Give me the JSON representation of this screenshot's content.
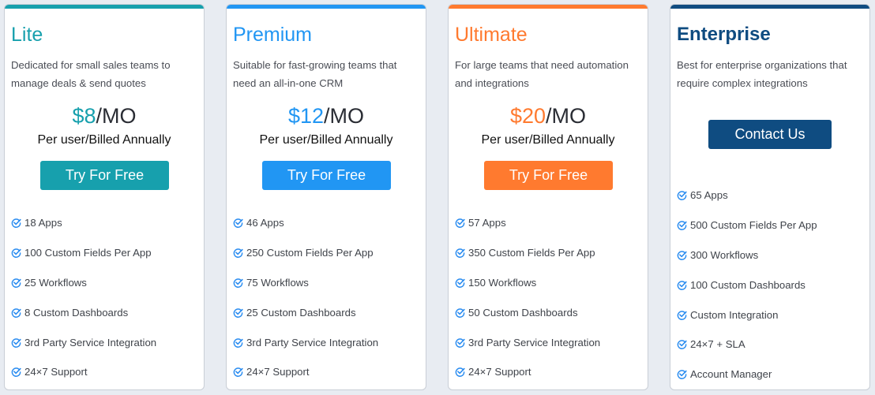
{
  "plans": [
    {
      "id": "lite",
      "name": "Lite",
      "accent": "#17a0ad",
      "title_color": "#17a0ad",
      "description": "Dedicated for small sales teams to manage deals & send quotes",
      "price_amount": "$8",
      "price_unit": "/MO",
      "billing": "Per user/Billed Annually",
      "cta_label": "Try For Free",
      "features": [
        "18 Apps",
        "100 Custom Fields Per App",
        "25 Workflows",
        "8 Custom Dashboards",
        "3rd Party Service Integration",
        "24×7 Support"
      ]
    },
    {
      "id": "premium",
      "name": "Premium",
      "accent": "#2196f3",
      "title_color": "#2196f3",
      "description": "Suitable for fast-growing teams that need an all-in-one CRM",
      "price_amount": "$12",
      "price_unit": "/MO",
      "billing": "Per user/Billed Annually",
      "cta_label": "Try For Free",
      "features": [
        "46 Apps",
        "250 Custom Fields Per App",
        "75 Workflows",
        "25 Custom Dashboards",
        "3rd Party Service Integration",
        "24×7 Support"
      ]
    },
    {
      "id": "ultimate",
      "name": "Ultimate",
      "accent": "#ff7a2f",
      "title_color": "#ff7a2f",
      "description": "For large teams that need automation and integrations",
      "price_amount": "$20",
      "price_unit": "/MO",
      "billing": "Per user/Billed Annually",
      "cta_label": "Try For Free",
      "features": [
        "57 Apps",
        "350 Custom Fields Per App",
        "150 Workflows",
        "50 Custom Dashboards",
        "3rd Party Service Integration",
        "24×7 Support"
      ]
    },
    {
      "id": "enterprise",
      "name": "Enterprise",
      "accent": "#0f4c81",
      "title_color": "#0f4c81",
      "description": "Best for enterprise organizations that require complex integrations",
      "cta_label": "Contact Us",
      "features": [
        "65 Apps",
        "500 Custom Fields Per App",
        "300 Workflows",
        "100 Custom Dashboards",
        "Custom Integration",
        "24×7 + SLA",
        "Account Manager"
      ]
    }
  ],
  "icons": {
    "feature": "check-circle-icon",
    "check_color": "#2a8cf0"
  }
}
